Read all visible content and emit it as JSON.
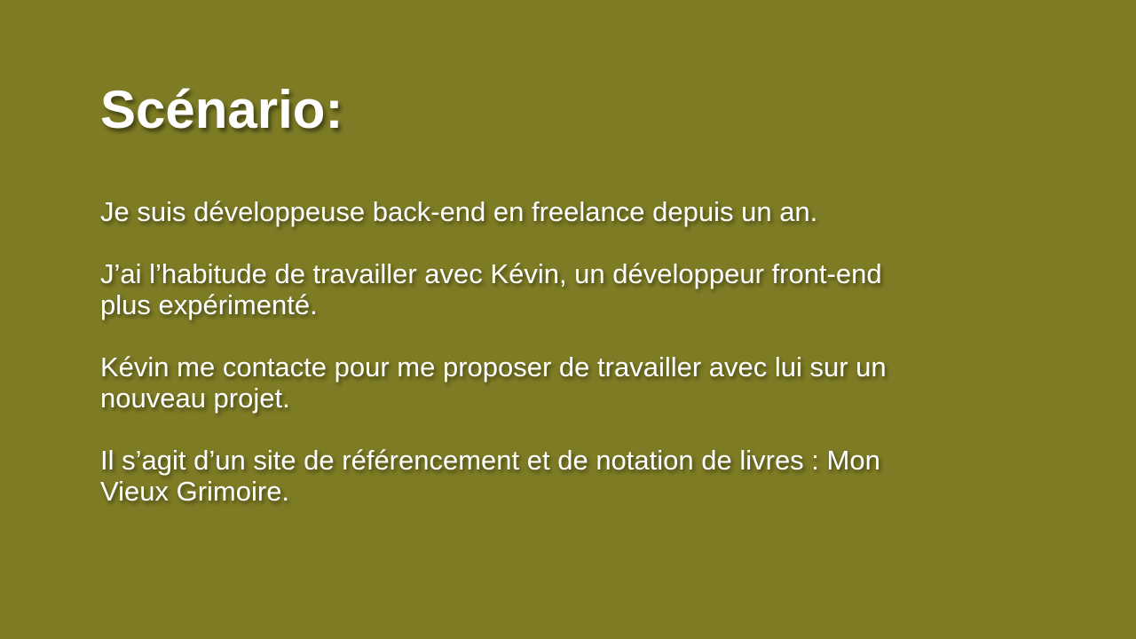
{
  "slide": {
    "background_color": "#7d7b24",
    "text_color": "#ffffff",
    "title": "Scénario:",
    "paragraphs": [
      {
        "lines": [
          "Je suis développeuse back-end en freelance depuis un an."
        ]
      },
      {
        "lines": [
          "J’ai l’habitude de travailler avec Kévin, un développeur front-end",
          "plus expérimenté."
        ]
      },
      {
        "lines": [
          "Kévin me contacte pour me proposer de travailler avec lui sur un",
          "nouveau projet."
        ]
      },
      {
        "lines": [
          "Il s’agit d’un site de référencement et de notation de livres : Mon",
          "Vieux Grimoire."
        ]
      }
    ]
  }
}
